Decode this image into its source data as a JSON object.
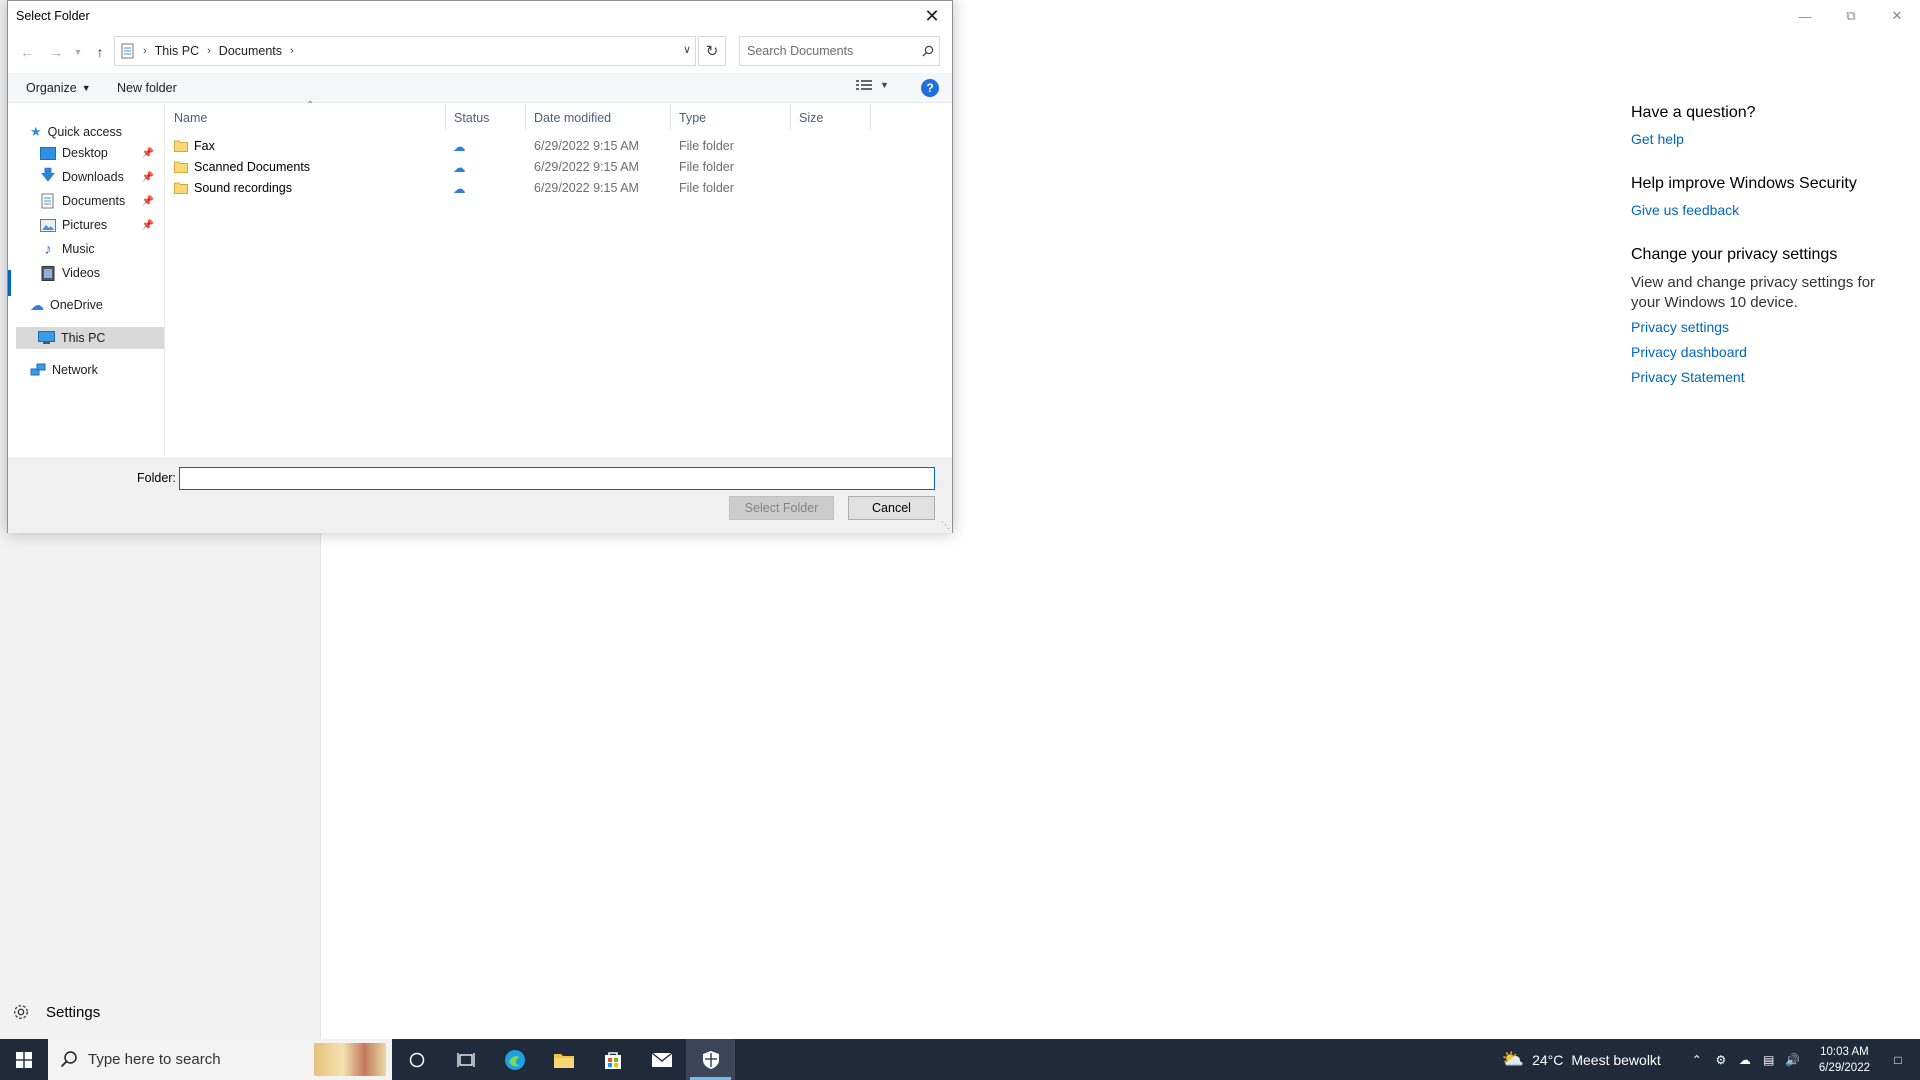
{
  "dialog": {
    "title": "Select Folder",
    "breadcrumb": [
      "This PC",
      "Documents"
    ],
    "search_placeholder": "Search Documents",
    "toolbar": {
      "organize": "Organize",
      "new_folder": "New folder",
      "help": "?"
    },
    "nav": {
      "quick_access": "Quick access",
      "items": [
        "Desktop",
        "Downloads",
        "Documents",
        "Pictures",
        "Music",
        "Videos"
      ],
      "onedrive": "OneDrive",
      "this_pc": "This PC",
      "network": "Network"
    },
    "columns": {
      "name": "Name",
      "status": "Status",
      "date": "Date modified",
      "type": "Type",
      "size": "Size"
    },
    "files": [
      {
        "name": "Fax",
        "date": "6/29/2022 9:15 AM",
        "type": "File folder"
      },
      {
        "name": "Scanned Documents",
        "date": "6/29/2022 9:15 AM",
        "type": "File folder"
      },
      {
        "name": "Sound recordings",
        "date": "6/29/2022 9:15 AM",
        "type": "File folder"
      }
    ],
    "folder_label": "Folder:",
    "folder_value": "",
    "select_button": "Select Folder",
    "cancel_button": "Cancel"
  },
  "background": {
    "settings_label": "Settings",
    "sections": [
      {
        "heading": "Have a question?",
        "links": [
          "Get help"
        ]
      },
      {
        "heading": "Help improve Windows Security",
        "links": [
          "Give us feedback"
        ]
      },
      {
        "heading": "Change your privacy settings",
        "text": "View and change privacy settings for your Windows 10 device.",
        "links": [
          "Privacy settings",
          "Privacy dashboard",
          "Privacy Statement"
        ]
      }
    ]
  },
  "taskbar": {
    "search_placeholder": "Type here to search",
    "weather_temp": "24°C",
    "weather_text": "Meest bewolkt",
    "time": "10:03 AM",
    "date": "6/29/2022"
  },
  "colors": {
    "accent": "#0067c0",
    "taskbar": "#1f2a3a",
    "help_blue": "#1f6fe0"
  }
}
